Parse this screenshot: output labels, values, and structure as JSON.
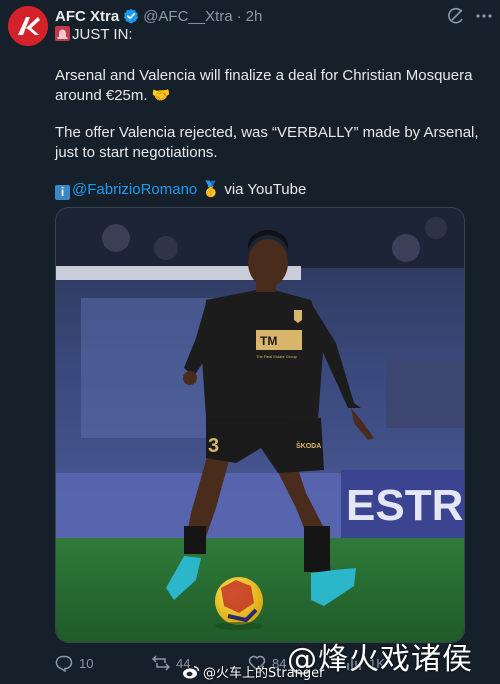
{
  "tweet": {
    "author_name": "AFC Xtra",
    "handle": "@AFC__Xtra",
    "separator": "·",
    "time": "2h",
    "line1": "JUST IN:",
    "line2": "Arsenal and Valencia will finalize a deal for Christian Mosquera around €25m. 🤝",
    "line3": "The offer Valencia rejected, was “VERBALLY” made by Arsenal, just to start negotiations.",
    "source_mention": "@FabrizioRomano",
    "source_suffix": "via YouTube",
    "info_glyph": "i",
    "medal_glyph": "🥇"
  },
  "photo": {
    "sponsor_logo_text": "TM",
    "sponsor_subtext": "The Real Estate Group",
    "shirt_number": "3",
    "sleeve_text": "ŠKODA",
    "board_text": "ESTR"
  },
  "actions": {
    "replies": "10",
    "reposts": "44",
    "likes": "84",
    "views": "1K"
  },
  "watermark": {
    "main": "@烽火戏诸侯",
    "sub": "@火车上的Stranger"
  },
  "colors": {
    "background": "#15202b",
    "accent": "#1d9bf0",
    "muted": "#8b98a5",
    "avatar": "#d3222a"
  }
}
